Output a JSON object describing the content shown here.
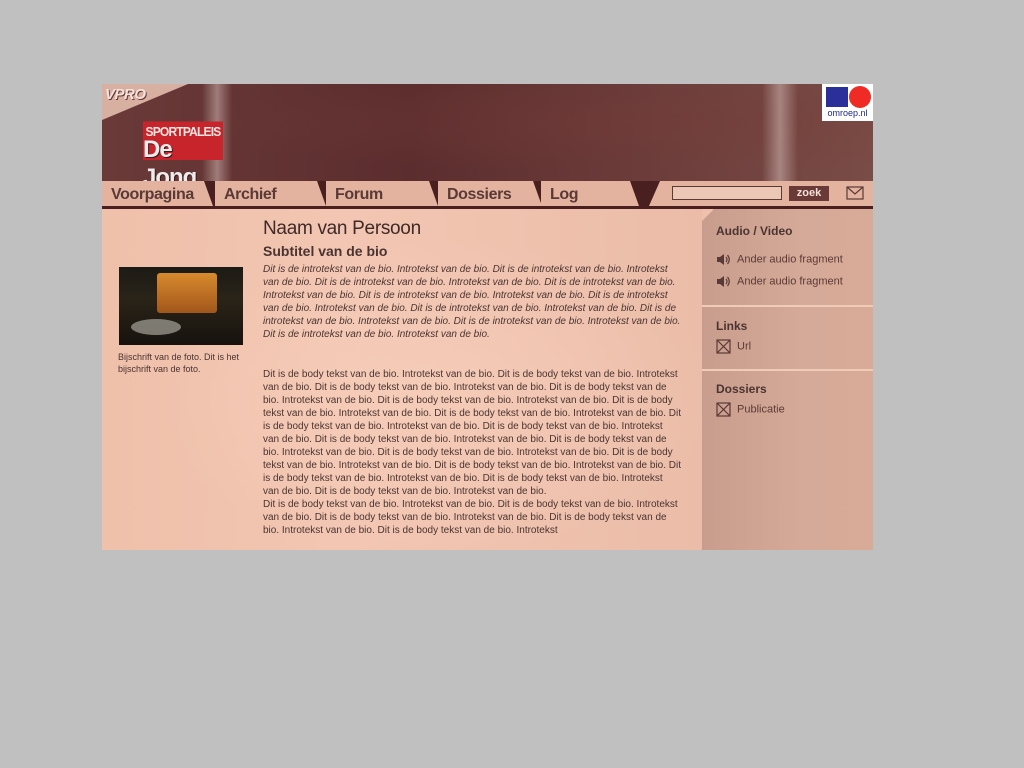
{
  "header": {
    "vpro_logo": "VPRO",
    "brand_top": "SPORTPALEIS",
    "brand_bottom": "De Jong",
    "omroep_label": "omroep.nl"
  },
  "nav": {
    "tabs": [
      {
        "label": "Voorpagina"
      },
      {
        "label": "Archief"
      },
      {
        "label": "Forum"
      },
      {
        "label": "Dossiers"
      },
      {
        "label": "Log"
      }
    ],
    "search": {
      "value": "",
      "button_label": "zoek"
    }
  },
  "main": {
    "photo_caption": "Bijschrift van de foto. Dit is het bijschrift van de foto.",
    "title": "Naam van Persoon",
    "subtitle": "Subtitel van de bio",
    "intro": "Dit is de introtekst van de bio. Introtekst van de bio. Dit is de introtekst van de bio. Introtekst van de bio. Dit is de introtekst van de bio. Introtekst van de bio. Dit is de introtekst van de bio. Introtekst van de bio. Dit is de introtekst van de bio. Introtekst van de bio. Dit is de introtekst van de bio. Introtekst van de bio. Dit is de introtekst van de bio. Introtekst van de bio. Dit is de introtekst van de bio. Introtekst van de bio. Dit is de introtekst van de bio. Introtekst van de bio. Dit is de introtekst van de bio. Introtekst van de bio.",
    "body": "Dit is de body tekst van de bio. Introtekst van de bio. Dit is de body tekst van de bio. Introtekst van de bio. Dit is de body tekst van de bio. Introtekst van de bio. Dit is de body tekst van de bio. Introtekst van de bio. Dit is de body tekst van de bio. Introtekst van de bio. Dit is de body tekst van de bio. Introtekst van de bio. Dit is de body tekst van de bio. Introtekst van de bio. Dit is de body tekst van de bio. Introtekst van de bio. Dit is de body tekst van de bio. Introtekst van de bio. Dit is de body tekst van de bio. Introtekst van de bio. Dit is de body tekst van de bio. Introtekst van de bio. Dit is de body tekst van de bio. Introtekst van de bio. Dit is de body tekst van de bio. Introtekst van de bio. Dit is de body tekst van de bio. Introtekst van de bio. Dit is de body tekst van de bio. Introtekst van de bio. Dit is de body tekst van de bio. Introtekst van de bio. Dit is de body tekst van de bio. Introtekst van de bio.\nDit is de body tekst van de bio. Introtekst van de bio. Dit is de body tekst van de bio. Introtekst van de bio. Dit is de body tekst van de bio. Introtekst van de bio. Dit is de body tekst van de bio. Introtekst van de bio. Dit is de body tekst van de bio. Introtekst"
  },
  "sidebar": {
    "sections": [
      {
        "title": "Audio / Video",
        "items": [
          {
            "label": "Ander audio fragment",
            "icon": "speaker-icon"
          },
          {
            "label": "Ander audio fragment",
            "icon": "speaker-icon"
          }
        ]
      },
      {
        "title": "Links",
        "items": [
          {
            "label": "Url",
            "icon": "link-box-icon"
          }
        ]
      },
      {
        "title": "Dossiers",
        "items": [
          {
            "label": "Publicatie",
            "icon": "link-box-icon"
          }
        ]
      }
    ]
  },
  "colors": {
    "page_bg": "#c0c0c0",
    "header_bg": "#5c2d2e",
    "tab_bg": "#e3b39f",
    "content_bg": "#f2c6b2",
    "sidebar_bg": "#d6aa98",
    "text": "#4a3431",
    "brand_red": "#c8242c",
    "omroep_blue": "#2b2f9a",
    "omroep_red": "#f02a24"
  }
}
